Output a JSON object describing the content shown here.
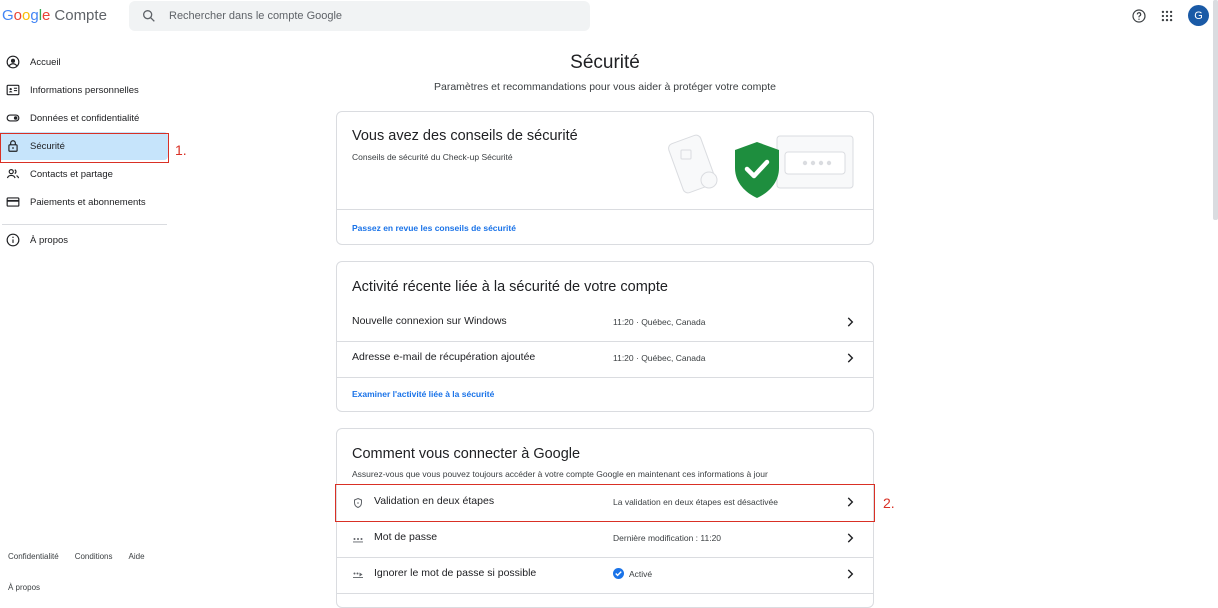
{
  "header": {
    "logo_parts": [
      "G",
      "o",
      "o",
      "g",
      "l",
      "e"
    ],
    "product": "Compte",
    "search_placeholder": "Rechercher dans le compte Google",
    "avatar_letter": "G"
  },
  "sidebar": {
    "items": [
      {
        "label": "Accueil",
        "icon": "account-circle-icon"
      },
      {
        "label": "Informations personnelles",
        "icon": "id-card-icon"
      },
      {
        "label": "Données et confidentialité",
        "icon": "toggle-icon"
      },
      {
        "label": "Sécurité",
        "icon": "lock-icon",
        "active": true
      },
      {
        "label": "Contacts et partage",
        "icon": "people-icon"
      },
      {
        "label": "Paiements et abonnements",
        "icon": "credit-card-icon"
      },
      {
        "label": "À propos",
        "icon": "info-icon"
      }
    ],
    "footer_links": [
      "Confidentialité",
      "Conditions",
      "Aide"
    ],
    "footer_apropos": "À propos"
  },
  "annotations": {
    "marker1": "1.",
    "marker2": "2."
  },
  "main": {
    "title": "Sécurité",
    "subtitle": "Paramètres et recommandations pour vous aider à protéger votre compte",
    "tips_card": {
      "title": "Vous avez des conseils de sécurité",
      "subtitle": "Conseils de sécurité du Check-up Sécurité",
      "link": "Passez en revue les conseils de sécurité"
    },
    "activity_card": {
      "title": "Activité récente liée à la sécurité de votre compte",
      "rows": [
        {
          "label": "Nouvelle connexion sur Windows",
          "value": "11:20 · Québec, Canada"
        },
        {
          "label": "Adresse e-mail de récupération ajoutée",
          "value": "11:20 · Québec, Canada"
        }
      ],
      "link": "Examiner l'activité liée à la sécurité"
    },
    "signin_card": {
      "title": "Comment vous connecter à Google",
      "subtitle": "Assurez-vous que vous pouvez toujours accéder à votre compte Google en maintenant ces informations à jour",
      "rows": [
        {
          "label": "Validation en deux étapes",
          "value": "La validation en deux étapes est désactivée",
          "icon": "shield-icon"
        },
        {
          "label": "Mot de passe",
          "value": "Dernière modification : 11:20",
          "icon": "password-dots-icon"
        },
        {
          "label": "Ignorer le mot de passe si possible",
          "value": "Activé",
          "icon": "passkey-icon"
        }
      ]
    }
  },
  "colors": {
    "accent": "#1a73e8",
    "active_nav": "#c6e4fb",
    "highlight": "#d93025",
    "shield": "#1e8e3e"
  }
}
